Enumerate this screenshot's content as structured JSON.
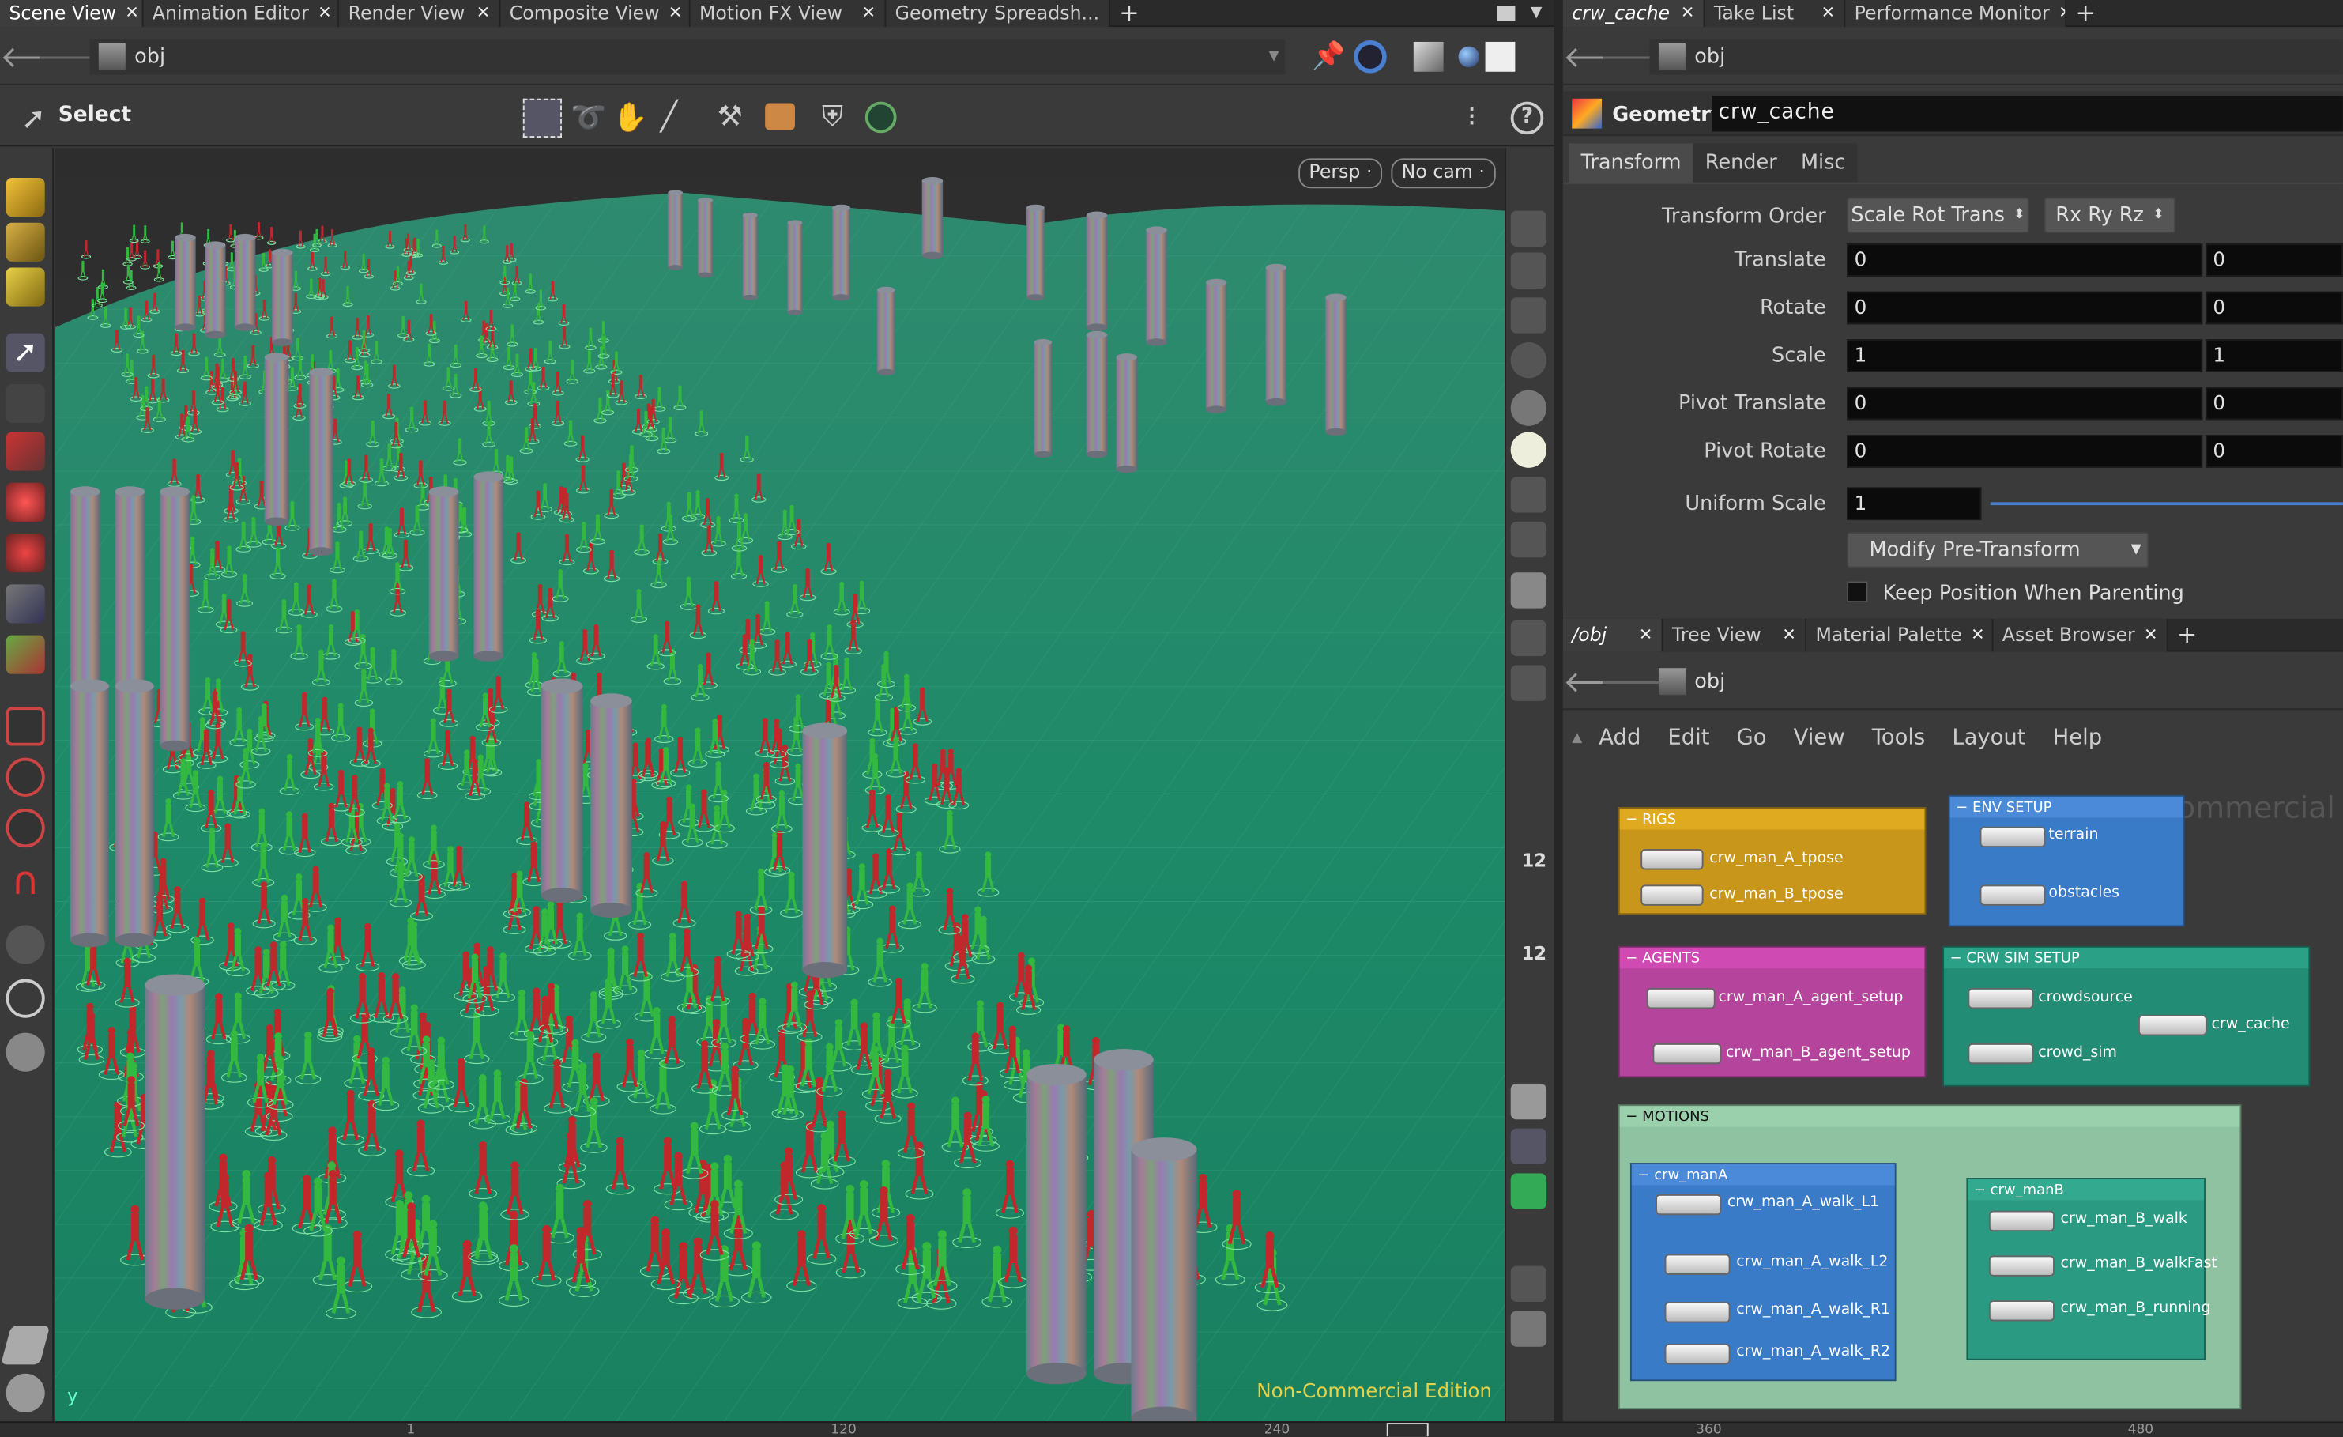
{
  "left_tabs": [
    "Scene View",
    "Animation Editor",
    "Render View",
    "Composite View",
    "Motion FX View",
    "Geometry Spreadsh..."
  ],
  "right_top_tabs": [
    "crw_cache",
    "Take List",
    "Performance Monitor"
  ],
  "right_bottom_tabs": [
    "/obj",
    "Tree View",
    "Material Palette",
    "Asset Browser"
  ],
  "path": "obj",
  "select_label": "Select",
  "viewport": {
    "persp": "Persp",
    "cam": "No cam",
    "watermark": "Non-Commercial Edition",
    "axis_label": "y"
  },
  "params": {
    "node_type": "Geometry",
    "node_name": "crw_cache",
    "tabs": [
      "Transform",
      "Render",
      "Misc"
    ],
    "transform_order_label": "Transform Order",
    "transform_order": "Scale Rot Trans",
    "rotate_order": "Rx Ry Rz",
    "rows": [
      {
        "label": "Translate",
        "v1": "0",
        "v2": "0"
      },
      {
        "label": "Rotate",
        "v1": "0",
        "v2": "0"
      },
      {
        "label": "Scale",
        "v1": "1",
        "v2": "1"
      },
      {
        "label": "Pivot Translate",
        "v1": "0",
        "v2": "0"
      },
      {
        "label": "Pivot Rotate",
        "v1": "0",
        "v2": "0"
      }
    ],
    "uniform_scale_label": "Uniform Scale",
    "uniform_scale": "1",
    "modify_btn": "Modify Pre-Transform",
    "keep_label": "Keep Position When Parenting"
  },
  "network": {
    "menu": [
      "Add",
      "Edit",
      "Go",
      "View",
      "Tools",
      "Layout",
      "Help"
    ],
    "watermark": "Non-Commercial",
    "boxes": {
      "rigs": "RIGS",
      "env": "ENV SETUP",
      "agents": "AGENTS",
      "crw": "CRW SIM SETUP",
      "motions": "MOTIONS",
      "manA": "crw_manA",
      "manB": "crw_manB"
    },
    "nodes": {
      "rig_a": "crw_man_A_tpose",
      "rig_b": "crw_man_B_tpose",
      "terrain": "terrain",
      "obstacles": "obstacles",
      "agent_a": "crw_man_A_agent_setup",
      "agent_b": "crw_man_B_agent_setup",
      "crowdsource": "crowdsource",
      "crowd_sim": "crowd_sim",
      "crw_cache": "crw_cache",
      "a_l1": "crw_man_A_walk_L1",
      "a_l2": "crw_man_A_walk_L2",
      "a_r1": "crw_man_A_walk_R1",
      "a_r2": "crw_man_A_walk_R2",
      "b_walk": "crw_man_B_walk",
      "b_fast": "crw_man_B_walkFast",
      "b_run": "crw_man_B_running"
    }
  },
  "timeline": {
    "ticks": [
      "1",
      "120",
      "240",
      "360",
      "480"
    ]
  },
  "colors": {
    "rigs": "#d4a017",
    "env": "#3a7bc8",
    "agents": "#c04aa8",
    "crw": "#2a9a82",
    "motions": "#8fc9a8",
    "terrain": "#1f8a6a",
    "agent_red": "#c0282c",
    "agent_green": "#33b840"
  }
}
